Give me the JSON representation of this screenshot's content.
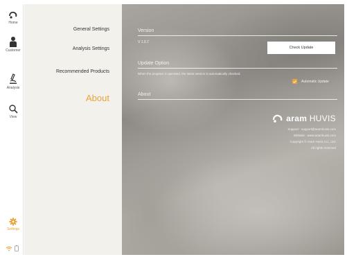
{
  "rail": {
    "items": [
      {
        "label": "Home",
        "icon": "home-icon"
      },
      {
        "label": "Customer",
        "icon": "customer-icon"
      },
      {
        "label": "Analysis",
        "icon": "analysis-icon"
      },
      {
        "label": "View",
        "icon": "view-icon"
      }
    ],
    "settings_label": "Settings"
  },
  "menu": {
    "items": [
      "General Settings",
      "Analysis Settings",
      "Recommended Products"
    ],
    "active": "About"
  },
  "main": {
    "version_title": "Version",
    "version_value": "V 1.0.7",
    "check_update": "Check Update",
    "update_title": "Update Option",
    "update_desc": "When the program is operated, the latest version is automatically checked.",
    "automatic_update": "Automatic Update",
    "about_title": "About",
    "brand_name": "aram",
    "brand_suffix": "HUVIS",
    "support": "Support : support@aramhuvis.com",
    "website": "Website : www.aramhuvis.com",
    "copyright": "Copyright © Aram Huvis Co., Ltd.",
    "rights": "All rights reserved"
  },
  "colors": {
    "accent": "#e8a33a",
    "menu_bg": "#f2f1ec"
  }
}
